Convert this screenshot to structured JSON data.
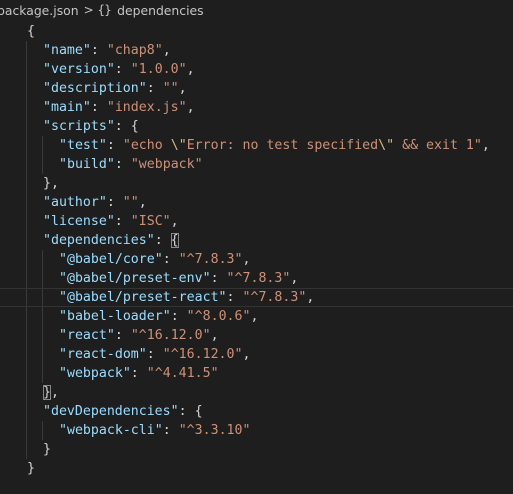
{
  "breadcrumb": {
    "file": "package.json",
    "separator": ">",
    "node_icon": "{}",
    "node": "dependencies"
  },
  "code": {
    "current_line": 14,
    "lines": [
      {
        "indent": 1,
        "tokens": [
          {
            "t": "p",
            "v": "{"
          }
        ]
      },
      {
        "indent": 2,
        "tokens": [
          {
            "t": "k",
            "v": "\"name\""
          },
          {
            "t": "p",
            "v": ": "
          },
          {
            "t": "s",
            "v": "\"chap8\""
          },
          {
            "t": "p",
            "v": ","
          }
        ]
      },
      {
        "indent": 2,
        "tokens": [
          {
            "t": "k",
            "v": "\"version\""
          },
          {
            "t": "p",
            "v": ": "
          },
          {
            "t": "s",
            "v": "\"1.0.0\""
          },
          {
            "t": "p",
            "v": ","
          }
        ]
      },
      {
        "indent": 2,
        "tokens": [
          {
            "t": "k",
            "v": "\"description\""
          },
          {
            "t": "p",
            "v": ": "
          },
          {
            "t": "s",
            "v": "\"\""
          },
          {
            "t": "p",
            "v": ","
          }
        ]
      },
      {
        "indent": 2,
        "tokens": [
          {
            "t": "k",
            "v": "\"main\""
          },
          {
            "t": "p",
            "v": ": "
          },
          {
            "t": "s",
            "v": "\"index.js\""
          },
          {
            "t": "p",
            "v": ","
          }
        ]
      },
      {
        "indent": 2,
        "tokens": [
          {
            "t": "k",
            "v": "\"scripts\""
          },
          {
            "t": "p",
            "v": ": {"
          }
        ]
      },
      {
        "indent": 3,
        "tokens": [
          {
            "t": "k",
            "v": "\"test\""
          },
          {
            "t": "p",
            "v": ": "
          },
          {
            "t": "s",
            "v": "\"echo "
          },
          {
            "t": "e",
            "v": "\\\""
          },
          {
            "t": "s",
            "v": "Error: no test specified"
          },
          {
            "t": "e",
            "v": "\\\""
          },
          {
            "t": "s",
            "v": " && exit 1\""
          },
          {
            "t": "p",
            "v": ","
          }
        ]
      },
      {
        "indent": 3,
        "tokens": [
          {
            "t": "k",
            "v": "\"build\""
          },
          {
            "t": "p",
            "v": ": "
          },
          {
            "t": "s",
            "v": "\"webpack\""
          }
        ]
      },
      {
        "indent": 2,
        "tokens": [
          {
            "t": "p",
            "v": "},"
          }
        ]
      },
      {
        "indent": 2,
        "tokens": [
          {
            "t": "k",
            "v": "\"author\""
          },
          {
            "t": "p",
            "v": ": "
          },
          {
            "t": "s",
            "v": "\"\""
          },
          {
            "t": "p",
            "v": ","
          }
        ]
      },
      {
        "indent": 2,
        "tokens": [
          {
            "t": "k",
            "v": "\"license\""
          },
          {
            "t": "p",
            "v": ": "
          },
          {
            "t": "s",
            "v": "\"ISC\""
          },
          {
            "t": "p",
            "v": ","
          }
        ]
      },
      {
        "indent": 2,
        "tokens": [
          {
            "t": "k",
            "v": "\"dependencies\""
          },
          {
            "t": "p",
            "v": ": "
          },
          {
            "t": "p",
            "v": "{",
            "m": true
          }
        ]
      },
      {
        "indent": 3,
        "tokens": [
          {
            "t": "k",
            "v": "\"@babel/core\""
          },
          {
            "t": "p",
            "v": ": "
          },
          {
            "t": "s",
            "v": "\"^7.8.3\""
          },
          {
            "t": "p",
            "v": ","
          }
        ]
      },
      {
        "indent": 3,
        "tokens": [
          {
            "t": "k",
            "v": "\"@babel/preset-env\""
          },
          {
            "t": "p",
            "v": ": "
          },
          {
            "t": "s",
            "v": "\"^7.8.3\""
          },
          {
            "t": "p",
            "v": ","
          }
        ]
      },
      {
        "indent": 3,
        "tokens": [
          {
            "t": "k",
            "v": "\"@babel/preset-react\""
          },
          {
            "t": "p",
            "v": ": "
          },
          {
            "t": "s",
            "v": "\"^7.8.3\""
          },
          {
            "t": "p",
            "v": ","
          }
        ]
      },
      {
        "indent": 3,
        "tokens": [
          {
            "t": "k",
            "v": "\"babel-loader\""
          },
          {
            "t": "p",
            "v": ": "
          },
          {
            "t": "s",
            "v": "\"^8.0.6\""
          },
          {
            "t": "p",
            "v": ","
          }
        ]
      },
      {
        "indent": 3,
        "tokens": [
          {
            "t": "k",
            "v": "\"react\""
          },
          {
            "t": "p",
            "v": ": "
          },
          {
            "t": "s",
            "v": "\"^16.12.0\""
          },
          {
            "t": "p",
            "v": ","
          }
        ]
      },
      {
        "indent": 3,
        "tokens": [
          {
            "t": "k",
            "v": "\"react-dom\""
          },
          {
            "t": "p",
            "v": ": "
          },
          {
            "t": "s",
            "v": "\"^16.12.0\""
          },
          {
            "t": "p",
            "v": ","
          }
        ]
      },
      {
        "indent": 3,
        "tokens": [
          {
            "t": "k",
            "v": "\"webpack\""
          },
          {
            "t": "p",
            "v": ": "
          },
          {
            "t": "s",
            "v": "\"^4.41.5\""
          }
        ]
      },
      {
        "indent": 2,
        "tokens": [
          {
            "t": "p",
            "v": "}",
            "m": true
          },
          {
            "t": "p",
            "v": ","
          }
        ]
      },
      {
        "indent": 2,
        "tokens": [
          {
            "t": "k",
            "v": "\"devDependencies\""
          },
          {
            "t": "p",
            "v": ": {"
          }
        ]
      },
      {
        "indent": 3,
        "tokens": [
          {
            "t": "k",
            "v": "\"webpack-cli\""
          },
          {
            "t": "p",
            "v": ": "
          },
          {
            "t": "s",
            "v": "\"^3.3.10\""
          }
        ]
      },
      {
        "indent": 2,
        "tokens": [
          {
            "t": "p",
            "v": "}"
          }
        ]
      },
      {
        "indent": 1,
        "tokens": [
          {
            "t": "p",
            "v": "}"
          }
        ]
      }
    ]
  },
  "colors": {
    "background": "#1e1e1e",
    "key": "#9cdcfe",
    "string": "#ce9178",
    "escape": "#d7ba7d",
    "punctuation": "#d4d4d4",
    "breadcrumb_text": "#c5c5c5"
  }
}
